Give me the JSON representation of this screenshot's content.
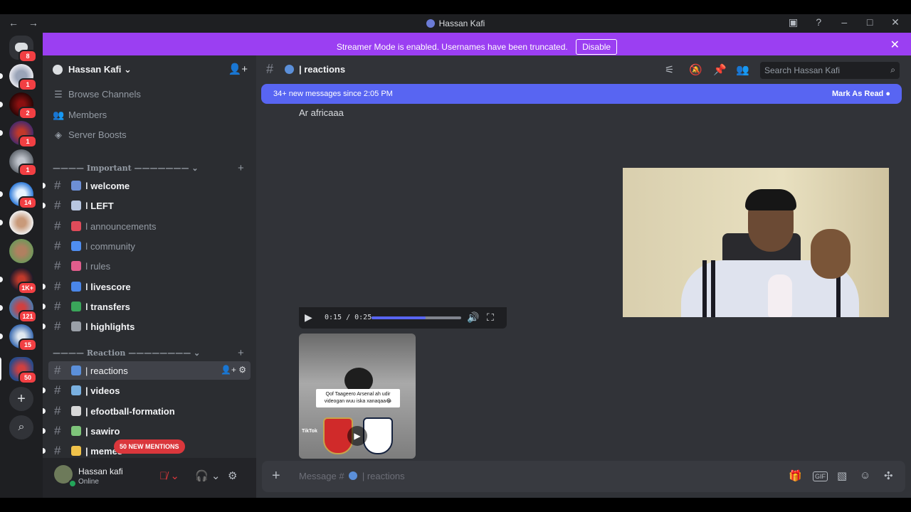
{
  "window": {
    "title": "Hassan Kafi",
    "back": "←",
    "forward": "→",
    "controls": [
      "–",
      "□",
      "✕"
    ]
  },
  "banner": {
    "message": "Streamer Mode is enabled. Usernames have been truncated.",
    "disable_label": "Disable",
    "close": "✕"
  },
  "rail": {
    "badges": [
      "8",
      "1",
      "2",
      "1",
      "1",
      "14",
      "1K+",
      "121",
      "15",
      "50"
    ],
    "add": "+",
    "explore": "⌕"
  },
  "server": {
    "name": "Hassan Kafi ⌄",
    "invite_icon": "add-member-icon"
  },
  "nav": {
    "browse": "Browse Channels",
    "members": "Members",
    "boosts": "Server Boosts"
  },
  "categories": {
    "important": "———— Important ———————  ⌄",
    "reaction": "———— Reaction ————————  ⌄"
  },
  "channels_important": [
    {
      "label": "ǀ welcome",
      "state": "unread",
      "emoji_color": "#6d8fd6"
    },
    {
      "label": "ǀ LEFT",
      "state": "unread",
      "emoji_color": "#b8c6e0"
    },
    {
      "label": "ǀ announcements",
      "state": "read",
      "emoji_color": "#e04b5a"
    },
    {
      "label": "ǀ community",
      "state": "read",
      "emoji_color": "#4f8ef0"
    },
    {
      "label": "ǀ rules",
      "state": "read",
      "emoji_color": "#e05d8c"
    },
    {
      "label": "ǀ livescore",
      "state": "unread",
      "emoji_color": "#4a86e8"
    },
    {
      "label": "ǀ transfers",
      "state": "unread",
      "emoji_color": "#3aa65a"
    },
    {
      "label": "ǀ highlights",
      "state": "unread",
      "emoji_color": "#9aa0a8"
    }
  ],
  "channels_reaction": [
    {
      "label": "| reactions",
      "state": "active",
      "emoji_color": "#5b8fd9"
    },
    {
      "label": "| videos",
      "state": "unread",
      "emoji_color": "#7ab0e0"
    },
    {
      "label": "| efootball-formation",
      "state": "unread",
      "emoji_color": "#d8d8d8"
    },
    {
      "label": "| sawiro",
      "state": "unread",
      "emoji_color": "#7ec47a"
    },
    {
      "label": "| memes",
      "state": "unread",
      "emoji_color": "#f0c24a"
    }
  ],
  "mentions_pill": "50 NEW MENTIONS",
  "user": {
    "name": "Hassan kafi",
    "status": "Online"
  },
  "chat": {
    "channel": "| reactions",
    "search_placeholder": "Search Hassan Kafi",
    "new_messages": "34+ new messages since 2:05 PM",
    "mark_read": "Mark As Read",
    "message_text": "Ar africaaa",
    "video_time": "0:15 / 0:25",
    "video_progress": 0.6,
    "thumb_caption": "Qof Taageero Arsenal ah udir videogan wuu iska xanaqaa😂",
    "thumb_badge": "TikTok",
    "composer_placeholder": "Message #",
    "composer_channel": "| reactions"
  }
}
